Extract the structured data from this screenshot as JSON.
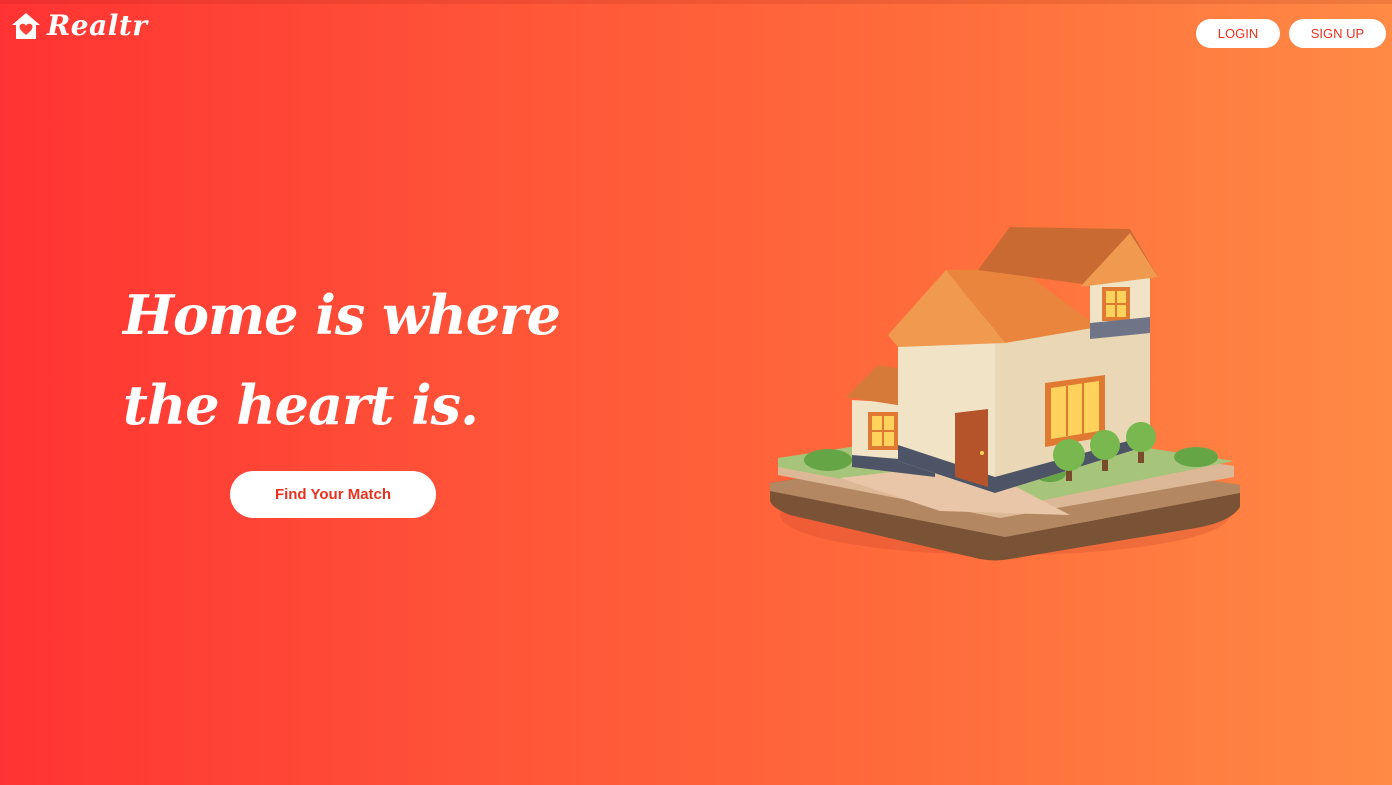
{
  "brand": {
    "name": "Realtr",
    "icon": "house-heart-icon"
  },
  "nav": {
    "login_label": "LOGIN",
    "signup_label": "SIGN UP"
  },
  "hero": {
    "headline_line1": "Home is where",
    "headline_line2": "the heart is.",
    "cta_label": "Find Your Match",
    "illustration": "3d-house-illustration"
  },
  "colors": {
    "gradient_start": "#ff3333",
    "gradient_end": "#ff8a45",
    "accent_text": "#e8321f",
    "button_bg": "#ffffff"
  }
}
